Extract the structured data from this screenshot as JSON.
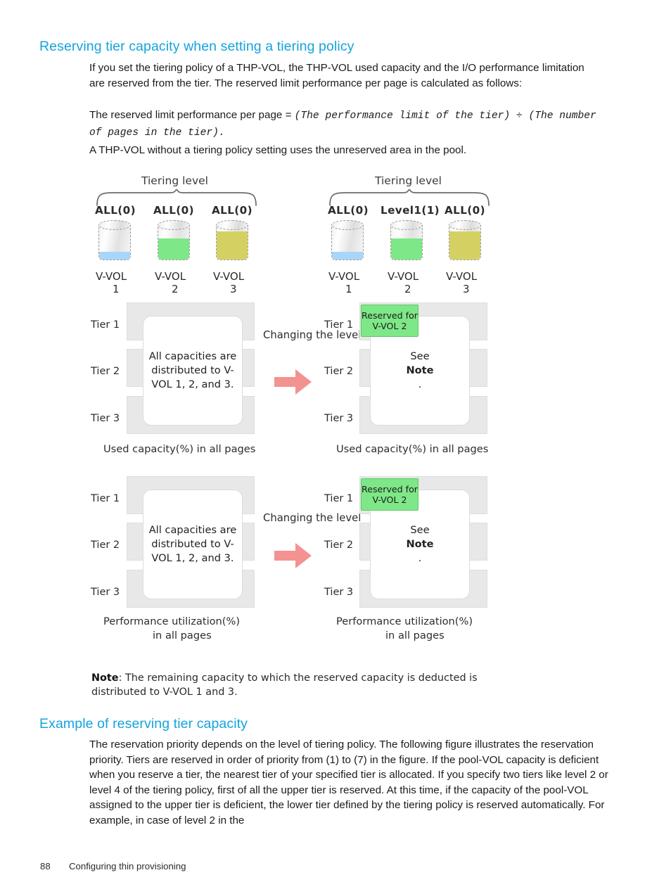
{
  "document": {
    "section1": {
      "heading": "Reserving tier capacity when setting a tiering policy",
      "para1": "If you set the tiering policy of a THP-VOL, the THP-VOL used capacity and the I/O performance limitation are reserved from the tier. The reserved limit performance per page is calculated as follows:",
      "para2_prefix": "The reserved limit performance per page = ",
      "para2_mono": "(The performance limit of the tier) ÷ (The number of pages in the tier).",
      "para3": "A THP-VOL without a tiering policy setting uses the unreserved area in the pool."
    },
    "section2": {
      "heading": "Example of reserving tier capacity",
      "para1": "The reservation priority depends on the level of tiering policy. The following figure illustrates the reservation priority. Tiers are reserved in order of priority from (1) to (7) in the figure. If the pool-VOL capacity is deficient when you reserve a tier, the nearest tier of your specified tier is allocated. If you specify two tiers like level 2 or level 4 of the tiering policy, first of all the upper tier is reserved. At this time, if the capacity of the pool-VOL assigned to the upper tier is deficient, the lower tier defined by the tiering policy is reserved automatically. For example, in case of level 2 in the"
    },
    "footer": {
      "page_number": "88",
      "chapter": "Configuring thin provisioning"
    }
  },
  "figure": {
    "left_group": {
      "brace_label": "Tiering level",
      "volumes": [
        {
          "policy": "ALL(0)",
          "name": "V-VOL",
          "index": "1",
          "fill_color": "#a8d5fa",
          "fill_pct": 22
        },
        {
          "policy": "ALL(0)",
          "name": "V-VOL",
          "index": "2",
          "fill_color": "#7ee787",
          "fill_pct": 62
        },
        {
          "policy": "ALL(0)",
          "name": "V-VOL",
          "index": "3",
          "fill_color": "#d4d162",
          "fill_pct": 82
        }
      ]
    },
    "right_group": {
      "brace_label": "Tiering level",
      "volumes": [
        {
          "policy": "ALL(0)",
          "name": "V-VOL",
          "index": "1",
          "fill_color": "#a8d5fa",
          "fill_pct": 22
        },
        {
          "policy": "Level1(1)",
          "name": "V-VOL",
          "index": "2",
          "fill_color": "#7ee787",
          "fill_pct": 62
        },
        {
          "policy": "ALL(0)",
          "name": "V-VOL",
          "index": "3",
          "fill_color": "#d4d162",
          "fill_pct": 82
        }
      ]
    },
    "tier_labels": {
      "tier1": "Tier 1",
      "tier2": "Tier 2",
      "tier3": "Tier 3"
    },
    "row1": {
      "before_box_text": "All capacities are distributed to V-VOL 1, 2, and 3.",
      "before_caption": "Used capacity(%) in all pages",
      "transition_label": "Changing the level",
      "reserved_label": "Reserved for V-VOL 2",
      "after_box_prefix": "See ",
      "after_box_bold": "Note",
      "after_box_suffix": ".",
      "after_caption": "Used capacity(%) in all pages"
    },
    "row2": {
      "before_box_text": "All capacities are distributed to V-VOL 1, 2, and 3.",
      "before_caption_line1": "Performance utilization(%)",
      "before_caption_line2": "in all pages",
      "transition_label": "Changing the level",
      "reserved_label": "Reserved for V-VOL 2",
      "after_box_prefix": "See ",
      "after_box_bold": "Note",
      "after_box_suffix": ".",
      "after_caption_line1": "Performance utilization(%)",
      "after_caption_line2": "in all pages"
    },
    "note": {
      "label": "Note",
      "text": ": The remaining capacity to which the reserved capacity is deducted is distributed to V-VOL 1 and 3."
    },
    "colors": {
      "heading_blue": "#15a3dd",
      "reserved_green": "#7ee787",
      "arrow_red": "#f49292",
      "tier_gray": "#e8e8e8"
    }
  }
}
